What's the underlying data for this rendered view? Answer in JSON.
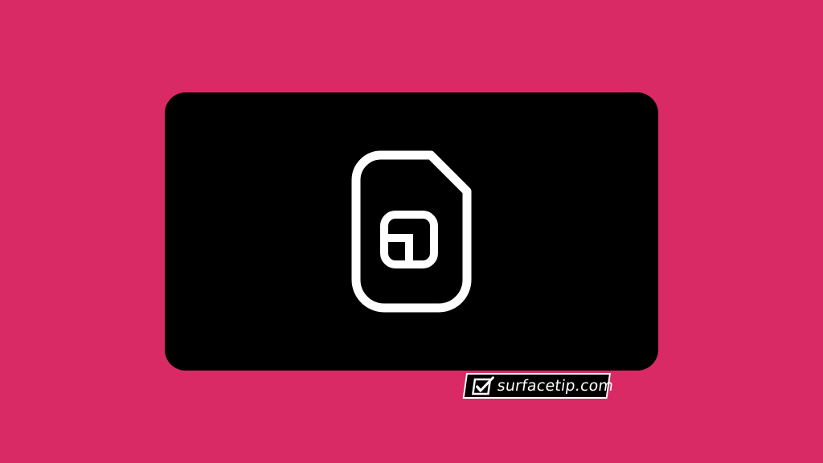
{
  "colors": {
    "background": "#d92a66",
    "card": "#000000",
    "icon": "#ffffff"
  },
  "icon": {
    "name": "sim-card-icon"
  },
  "watermark": {
    "text": "surfacetip.com",
    "icon": "checkbox-check-icon"
  }
}
